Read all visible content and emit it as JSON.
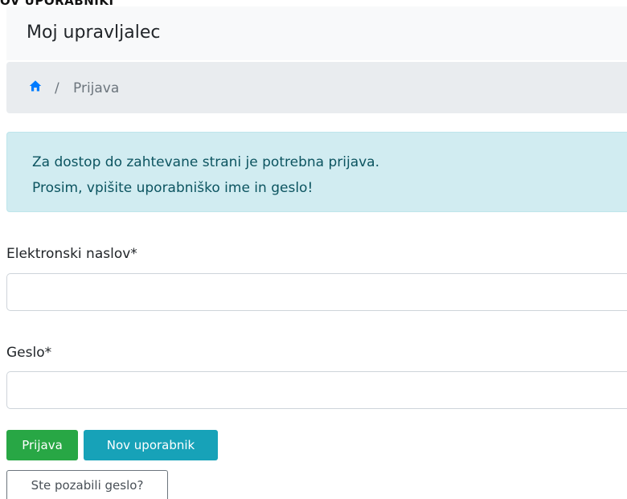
{
  "page_heading_cut": "OV UPORABNIKI",
  "navbar": {
    "brand": "Moj upravljalec"
  },
  "breadcrumb": {
    "home_icon": "home-icon",
    "separator": "/",
    "active": "Prijava"
  },
  "alert": {
    "line1": "Za dostop do zahtevane strani je potrebna prijava.",
    "line2": "Prosim, vpišite uporabniško ime in geslo!"
  },
  "form": {
    "email_label": "Elektronski naslov*",
    "email_value": "",
    "password_label": "Geslo*",
    "password_value": ""
  },
  "buttons": {
    "login": "Prijava",
    "new_user": "Nov uporabnik",
    "forgot_password": "Ste pozabili geslo?"
  },
  "colors": {
    "primary_link": "#007bff",
    "success": "#28a745",
    "info": "#17a2b8",
    "alert_bg": "#d1ecf1",
    "alert_text": "#0c5460",
    "breadcrumb_bg": "#e9ecef",
    "navbar_bg": "#f8f9fa"
  }
}
